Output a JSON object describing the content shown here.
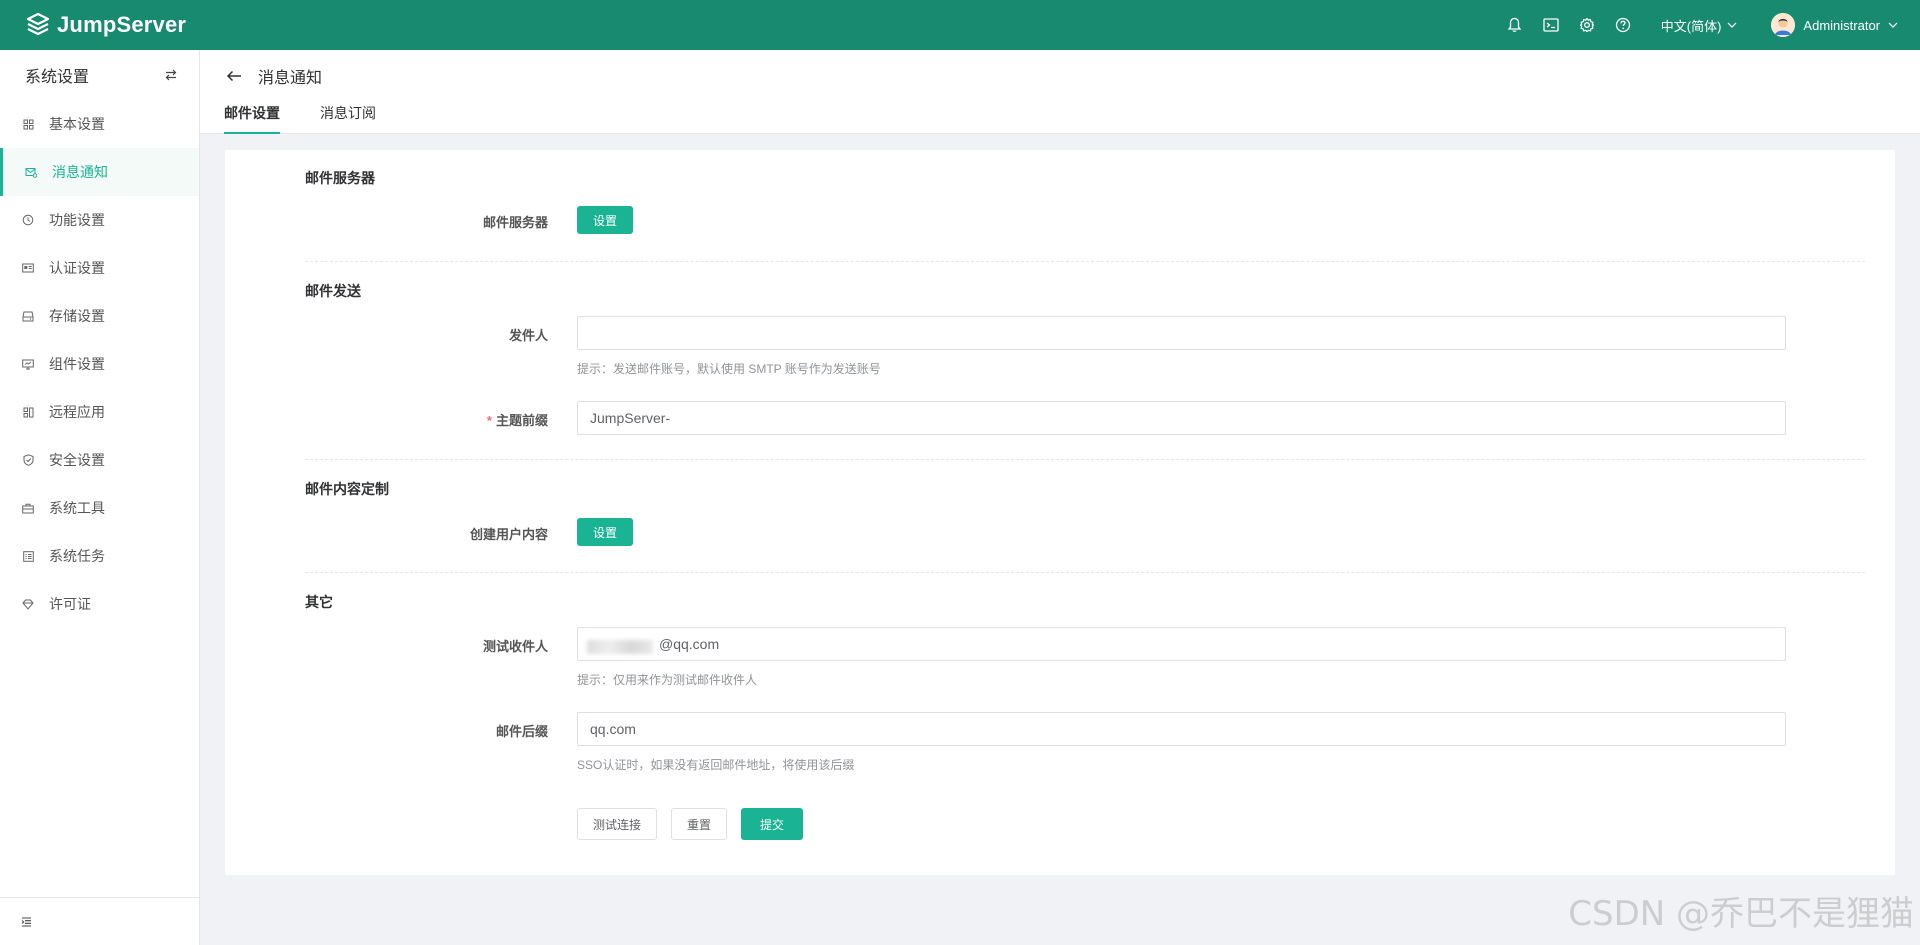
{
  "header": {
    "logo_text": "JumpServer",
    "language": "中文(简体)",
    "username": "Administrator",
    "icons": [
      "bell-icon",
      "terminal-icon",
      "gear-icon",
      "help-icon"
    ]
  },
  "sidebar": {
    "title": "系统设置",
    "items": [
      {
        "label": "基本设置",
        "icon": "grid-icon"
      },
      {
        "label": "消息通知",
        "icon": "message-icon",
        "active": true
      },
      {
        "label": "功能设置",
        "icon": "feature-icon"
      },
      {
        "label": "认证设置",
        "icon": "id-card-icon"
      },
      {
        "label": "存储设置",
        "icon": "storage-icon"
      },
      {
        "label": "组件设置",
        "icon": "monitor-icon"
      },
      {
        "label": "远程应用",
        "icon": "apps-icon"
      },
      {
        "label": "安全设置",
        "icon": "shield-icon"
      },
      {
        "label": "系统工具",
        "icon": "toolbox-icon"
      },
      {
        "label": "系统任务",
        "icon": "task-icon"
      },
      {
        "label": "许可证",
        "icon": "license-icon"
      }
    ]
  },
  "page": {
    "title": "消息通知",
    "tabs": [
      {
        "label": "邮件设置",
        "active": true
      },
      {
        "label": "消息订阅"
      }
    ]
  },
  "form": {
    "sections": {
      "server": "邮件服务器",
      "sending": "邮件发送",
      "content": "邮件内容定制",
      "other": "其它"
    },
    "mail_server_label": "邮件服务器",
    "mail_server_button": "设置",
    "sender_label": "发件人",
    "sender_value": "",
    "sender_hint": "提示：发送邮件账号，默认使用 SMTP 账号作为发送账号",
    "subject_prefix_label": "主题前缀",
    "subject_prefix_required_mark": "*",
    "subject_prefix_value": "JumpServer-",
    "create_user_content_label": "创建用户内容",
    "create_user_content_button": "设置",
    "test_recipient_label": "测试收件人",
    "test_recipient_value": "@qq.com",
    "test_recipient_hint": "提示：仅用来作为测试邮件收件人",
    "mail_suffix_label": "邮件后缀",
    "mail_suffix_value": "qq.com",
    "mail_suffix_hint": "SSO认证时，如果没有返回邮件地址，将使用该后缀",
    "buttons": {
      "test": "测试连接",
      "reset": "重置",
      "submit": "提交"
    }
  },
  "watermark": "CSDN @乔巴不是狸猫",
  "colors": {
    "header_bg": "#188a70",
    "accent": "#1ab394"
  }
}
